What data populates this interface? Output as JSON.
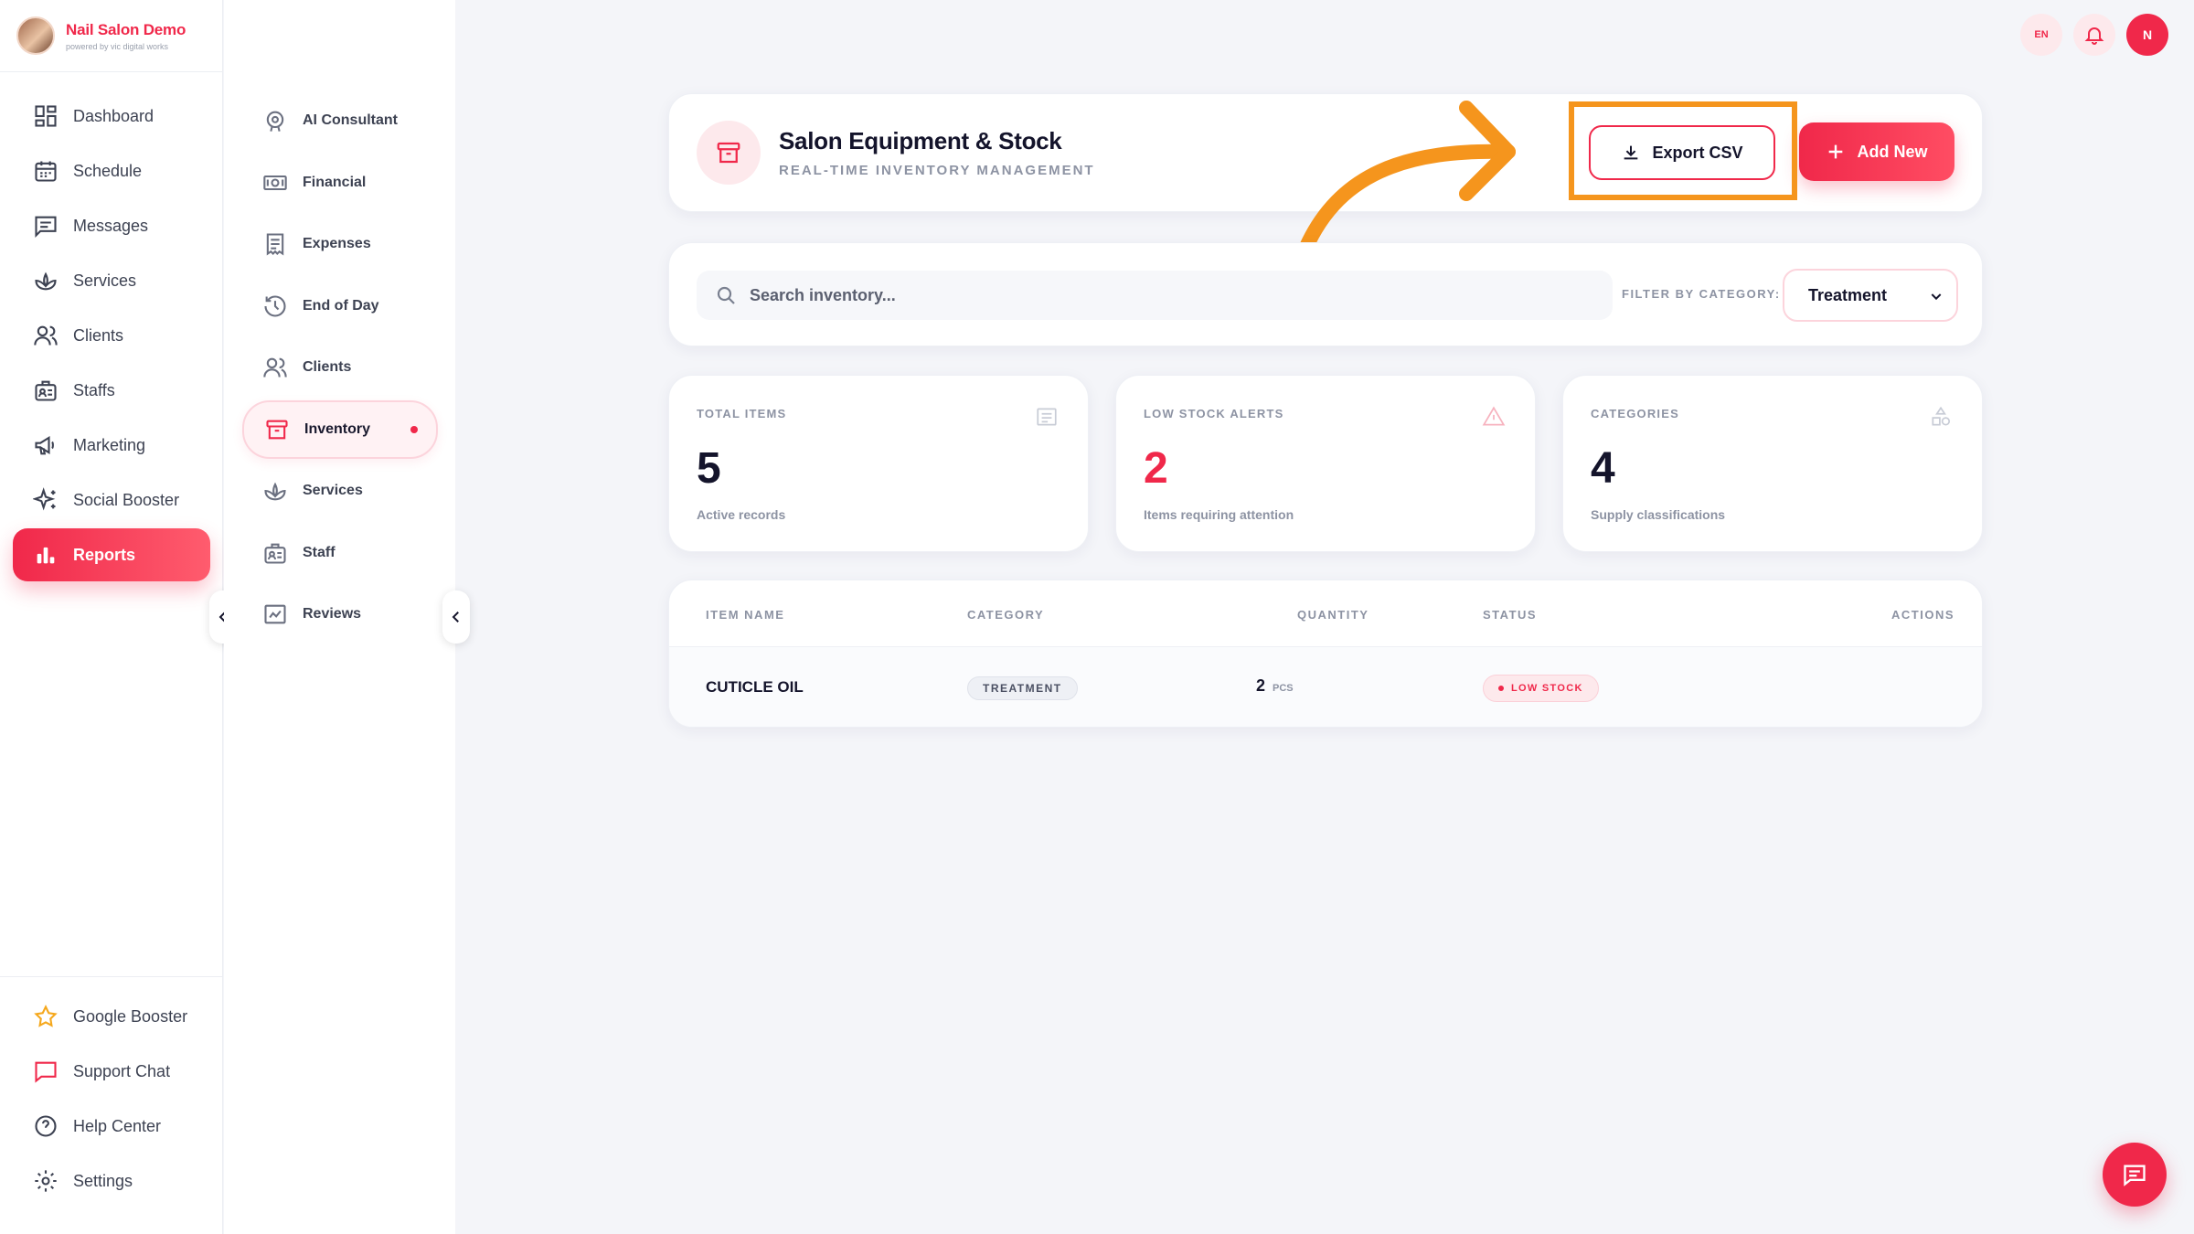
{
  "brand": {
    "name": "Nail Salon Demo",
    "tagline": "powered by vic digital works"
  },
  "nav": {
    "items": [
      {
        "label": "Dashboard",
        "icon": "dashboard-icon"
      },
      {
        "label": "Schedule",
        "icon": "calendar-icon"
      },
      {
        "label": "Messages",
        "icon": "messages-icon"
      },
      {
        "label": "Services",
        "icon": "lotus-icon"
      },
      {
        "label": "Clients",
        "icon": "users-icon"
      },
      {
        "label": "Staffs",
        "icon": "staff-icon"
      },
      {
        "label": "Marketing",
        "icon": "megaphone-icon"
      },
      {
        "label": "Social Booster",
        "icon": "sparkles-icon"
      },
      {
        "label": "Reports",
        "icon": "bar-chart-icon",
        "active": true
      }
    ],
    "bottom": [
      {
        "label": "Google Booster",
        "icon": "star-icon"
      },
      {
        "label": "Support Chat",
        "icon": "chat-icon"
      },
      {
        "label": "Help Center",
        "icon": "help-icon"
      },
      {
        "label": "Settings",
        "icon": "gear-icon"
      }
    ]
  },
  "subnav": {
    "items": [
      {
        "label": "AI Consultant",
        "icon": "ai-icon"
      },
      {
        "label": "Financial",
        "icon": "cash-icon"
      },
      {
        "label": "Expenses",
        "icon": "receipt-icon"
      },
      {
        "label": "End of Day",
        "icon": "history-icon"
      },
      {
        "label": "Clients",
        "icon": "users-icon"
      },
      {
        "label": "Inventory",
        "icon": "archive-icon",
        "active": true
      },
      {
        "label": "Services",
        "icon": "lotus-icon"
      },
      {
        "label": "Staff",
        "icon": "staff-icon"
      },
      {
        "label": "Reviews",
        "icon": "review-icon"
      }
    ]
  },
  "topbar": {
    "lang": "EN",
    "user_initial": "N"
  },
  "header": {
    "title": "Salon Equipment & Stock",
    "subtitle": "REAL-TIME INVENTORY MANAGEMENT",
    "export_label": "Export CSV",
    "add_label": "Add New"
  },
  "search": {
    "placeholder": "Search inventory...",
    "filter_label": "FILTER BY CATEGORY:",
    "filter_value": "Treatment"
  },
  "stats": [
    {
      "label": "TOTAL ITEMS",
      "value": "5",
      "sub": "Active records"
    },
    {
      "label": "LOW STOCK ALERTS",
      "value": "2",
      "sub": "Items requiring attention"
    },
    {
      "label": "CATEGORIES",
      "value": "4",
      "sub": "Supply classifications"
    }
  ],
  "table": {
    "headers": {
      "name": "ITEM NAME",
      "category": "CATEGORY",
      "quantity": "QUANTITY",
      "status": "STATUS",
      "actions": "ACTIONS"
    },
    "rows": [
      {
        "name": "CUTICLE OIL",
        "category": "TREATMENT",
        "qty": "2",
        "unit": "PCS",
        "status": "LOW STOCK"
      }
    ]
  },
  "colors": {
    "accent": "#f0284a",
    "annotation": "#f5951d"
  }
}
